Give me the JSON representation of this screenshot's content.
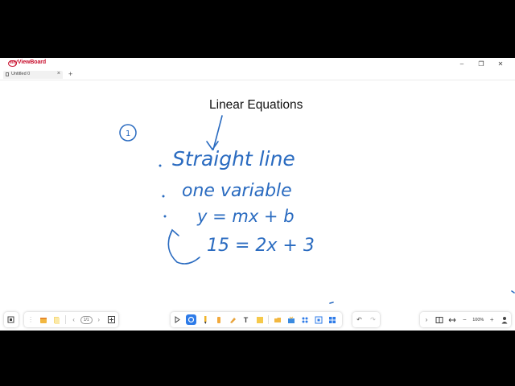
{
  "app": {
    "name": "myViewBoard"
  },
  "window_controls": {
    "minimize": "–",
    "restore": "❐",
    "close": "✕"
  },
  "tabs": [
    {
      "label": "Untitled 0"
    }
  ],
  "tab_close": "×",
  "add_tab": "+",
  "canvas": {
    "title": "Linear Equations",
    "handwriting": [
      "①",
      "Straight line",
      "one variable",
      "y = mx + b",
      "15 = 2x + 3"
    ]
  },
  "bottom_left_toolbar": {
    "page_indicator": "1/1"
  },
  "bottom_right_toolbar": {
    "zoom": "100%"
  },
  "icons": {
    "fit": "fit-screen-icon",
    "drag": "drag-handle-icon",
    "select": "select-pointer-icon",
    "pen": "pen-icon",
    "marker": "marker-icon",
    "highlighter": "highlighter-icon",
    "eraser": "eraser-icon",
    "text": "text-icon",
    "sticky": "sticky-note-icon",
    "folder": "folder-icon",
    "magic": "magic-box-icon",
    "shapes": "shapes-icon",
    "capture": "screen-capture-icon",
    "apps": "apps-grid-icon",
    "undo": "undo-icon",
    "redo": "redo-icon"
  }
}
